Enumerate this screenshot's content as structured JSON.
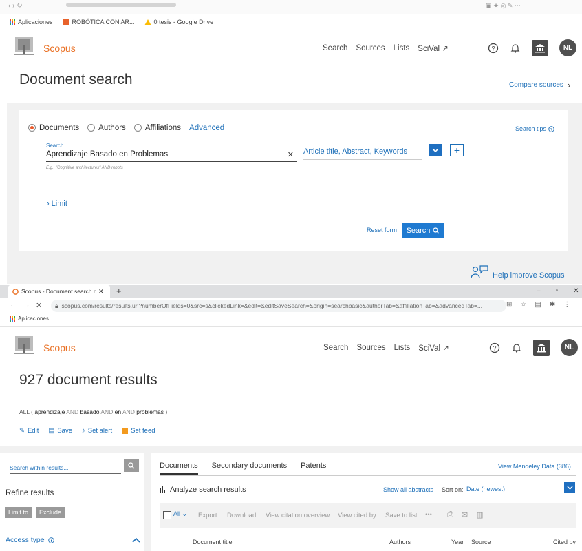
{
  "bookmarks": {
    "apps": "Aplicaciones",
    "items": [
      "ROBÓTICA CON AR...",
      "0 tesis - Google Drive"
    ]
  },
  "header1": {
    "brand": "Scopus",
    "nav": [
      "Search",
      "Sources",
      "Lists",
      "SciVal ↗"
    ],
    "avatar": "NL"
  },
  "search_page": {
    "title": "Document search",
    "compare_sources": "Compare sources",
    "radios": [
      "Documents",
      "Authors",
      "Affiliations"
    ],
    "advanced": "Advanced",
    "search_tips": "Search tips",
    "field_label": "Search",
    "field_value": "Aprendizaje Basado en Problemas",
    "field_hint": "E.g., \"Cognitive architectures\" AND robots",
    "field_type": "Article title, Abstract, Keywords",
    "limit": "Limit",
    "reset": "Reset form",
    "search_btn": "Search",
    "help": "Help improve Scopus"
  },
  "browser2": {
    "tab_title": "Scopus - Document search results",
    "url": "scopus.com/results/results.uri?numberOfFields=0&src=s&clickedLink=&edit=&editSaveSearch=&origin=searchbasic&authorTab=&affiliationTab=&advancedTab=...",
    "apps": "Aplicaciones",
    "win_min": "–",
    "win_max": "▫",
    "win_close": "✕"
  },
  "header2": {
    "brand": "Scopus",
    "nav": [
      "Search",
      "Sources",
      "Lists",
      "SciVal ↗"
    ],
    "avatar": "NL"
  },
  "results": {
    "title": "927 document results",
    "query_parts": [
      "ALL ( ",
      "aprendizaje",
      " AND ",
      "basado",
      " AND ",
      "en",
      " AND ",
      "problemas",
      " )"
    ],
    "actions": [
      "Edit",
      "Save",
      "Set alert",
      "Set feed"
    ],
    "search_within_placeholder": "Search within results...",
    "refine": "Refine results",
    "limit_to": "Limit to",
    "exclude": "Exclude",
    "access_type": "Access type",
    "tabs": [
      "Documents",
      "Secondary documents",
      "Patents"
    ],
    "mendeley": "View Mendeley Data (386)",
    "analyze": "Analyze search results",
    "show_abstracts": "Show all abstracts",
    "sort_label": "Sort on:",
    "sort_value": "Date (newest)",
    "toolbar": [
      "All",
      "Export",
      "Download",
      "View citation overview",
      "View cited by",
      "Save to list",
      "•••"
    ],
    "columns": [
      "Document title",
      "Authors",
      "Year",
      "Source",
      "Cited by"
    ]
  },
  "colors": {
    "accent": "#1d6fb8",
    "brand": "#ea7125",
    "button": "#1f7ad1"
  }
}
